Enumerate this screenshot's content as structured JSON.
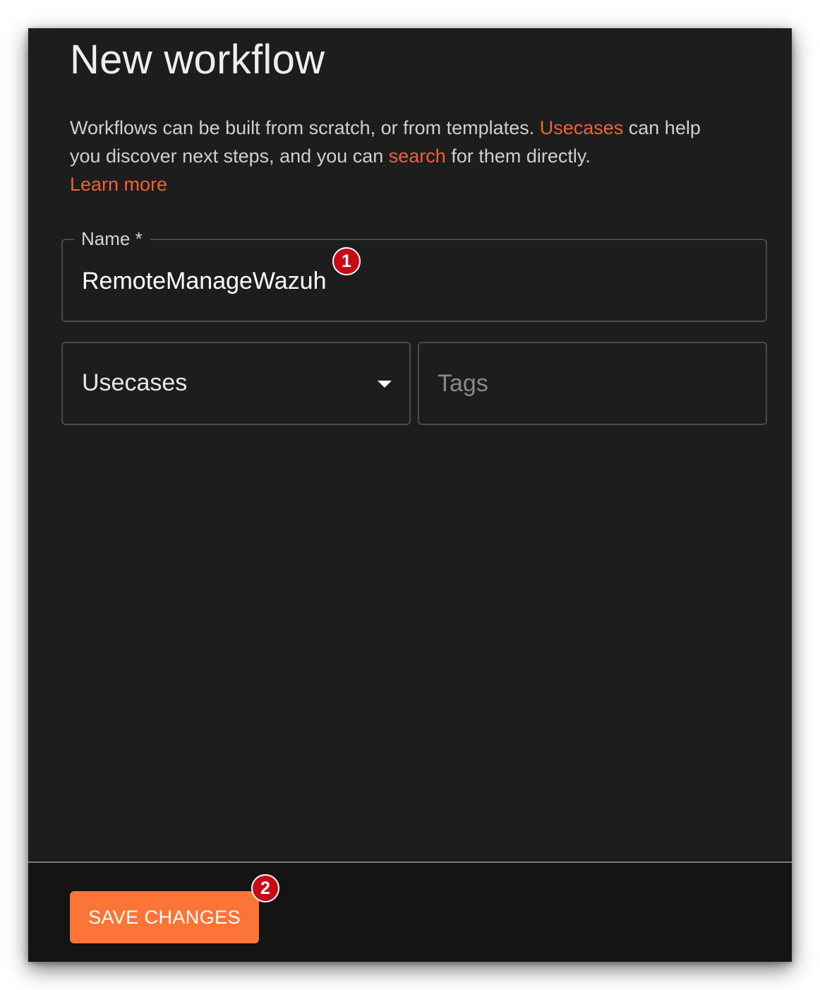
{
  "dialog": {
    "title": "New workflow",
    "description": {
      "part1": "Workflows can be built from scratch, or from templates. ",
      "usecases_link": "Usecases",
      "part2": " can help you discover next steps, and you can ",
      "search_link": "search",
      "part3": " for them directly.",
      "learn_more_link": "Learn more"
    },
    "link_color": "#f0603a"
  },
  "form": {
    "name_label": "Name *",
    "name_value": "RemoteManageWazuh",
    "usecases_label": "Usecases",
    "tags_placeholder": "Tags"
  },
  "footer": {
    "save_label": "SAVE CHANGES",
    "save_color": "#fc7436"
  },
  "annotations": {
    "badge_1": "1",
    "badge_2": "2",
    "badge_color": "#c70a16"
  }
}
